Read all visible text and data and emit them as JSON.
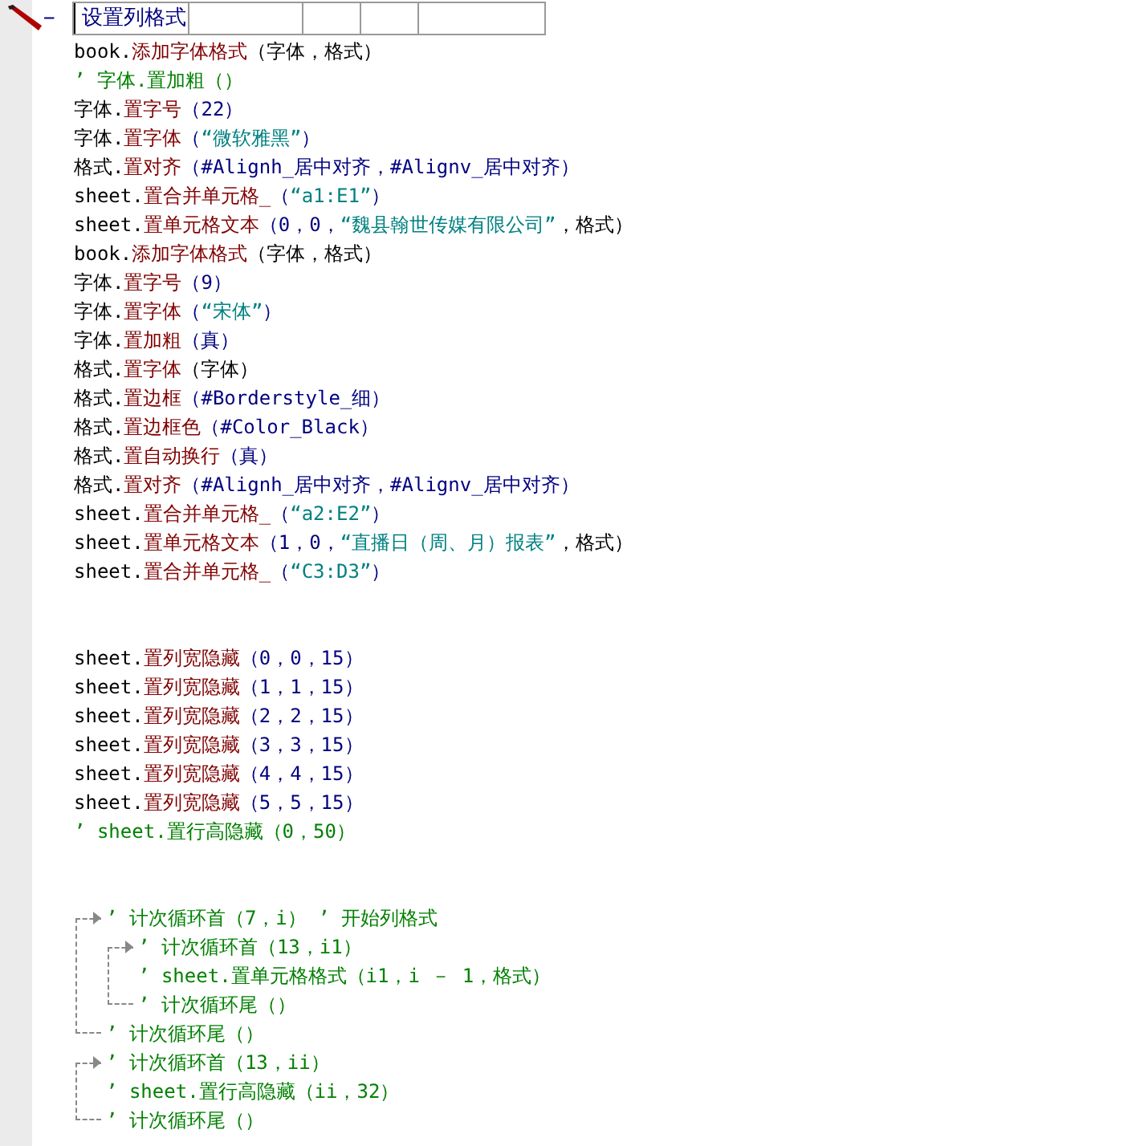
{
  "header": {
    "collapse_sign": "−",
    "title": "设置列格式"
  },
  "blocks": [
    {
      "items": [
        {
          "kind": "line",
          "segments": [
            {
              "text": "book.",
              "kind": "plain"
            },
            {
              "text": "添加字体格式",
              "kind": "method"
            },
            {
              "text": "（字体，格式）",
              "kind": "plain"
            }
          ]
        },
        {
          "kind": "line",
          "segments": [
            {
              "text": "’ 字体.置加粗（）",
              "kind": "comment"
            }
          ]
        },
        {
          "kind": "line",
          "segments": [
            {
              "text": "字体.",
              "kind": "plain"
            },
            {
              "text": "置字号",
              "kind": "method"
            },
            {
              "text": "（22）",
              "kind": "arg"
            }
          ]
        },
        {
          "kind": "line",
          "segments": [
            {
              "text": "字体.",
              "kind": "plain"
            },
            {
              "text": "置字体",
              "kind": "method"
            },
            {
              "text": "（",
              "kind": "arg"
            },
            {
              "text": "“微软雅黑”",
              "kind": "str"
            },
            {
              "text": "）",
              "kind": "arg"
            }
          ]
        },
        {
          "kind": "line",
          "segments": [
            {
              "text": "格式.",
              "kind": "plain"
            },
            {
              "text": "置对齐",
              "kind": "method"
            },
            {
              "text": "（#Alignh_居中对齐，#Alignv_居中对齐）",
              "kind": "arg"
            }
          ]
        },
        {
          "kind": "line",
          "segments": [
            {
              "text": "sheet.",
              "kind": "plain"
            },
            {
              "text": "置合并单元格_",
              "kind": "method"
            },
            {
              "text": "（",
              "kind": "arg"
            },
            {
              "text": "“a1:E1”",
              "kind": "str"
            },
            {
              "text": "）",
              "kind": "arg"
            }
          ]
        },
        {
          "kind": "line",
          "segments": [
            {
              "text": "sheet.",
              "kind": "plain"
            },
            {
              "text": "置单元格文本",
              "kind": "method"
            },
            {
              "text": "（0，0，",
              "kind": "arg"
            },
            {
              "text": "“魏县翰世传媒有限公司”",
              "kind": "str"
            },
            {
              "text": "，格式）",
              "kind": "plain"
            }
          ]
        },
        {
          "kind": "line",
          "segments": [
            {
              "text": "book.",
              "kind": "plain"
            },
            {
              "text": "添加字体格式",
              "kind": "method"
            },
            {
              "text": "（字体，格式）",
              "kind": "plain"
            }
          ]
        },
        {
          "kind": "line",
          "segments": [
            {
              "text": "字体.",
              "kind": "plain"
            },
            {
              "text": "置字号",
              "kind": "method"
            },
            {
              "text": "（9）",
              "kind": "arg"
            }
          ]
        },
        {
          "kind": "line",
          "segments": [
            {
              "text": "字体.",
              "kind": "plain"
            },
            {
              "text": "置字体",
              "kind": "method"
            },
            {
              "text": "（",
              "kind": "arg"
            },
            {
              "text": "“宋体”",
              "kind": "str"
            },
            {
              "text": "）",
              "kind": "arg"
            }
          ]
        },
        {
          "kind": "line",
          "segments": [
            {
              "text": "字体.",
              "kind": "plain"
            },
            {
              "text": "置加粗",
              "kind": "method"
            },
            {
              "text": "（真）",
              "kind": "arg"
            }
          ]
        },
        {
          "kind": "line",
          "segments": [
            {
              "text": "格式.",
              "kind": "plain"
            },
            {
              "text": "置字体",
              "kind": "method"
            },
            {
              "text": "（字体）",
              "kind": "plain"
            }
          ]
        },
        {
          "kind": "line",
          "segments": [
            {
              "text": "格式.",
              "kind": "plain"
            },
            {
              "text": "置边框",
              "kind": "method"
            },
            {
              "text": "（#Borderstyle_细）",
              "kind": "arg"
            }
          ]
        },
        {
          "kind": "line",
          "segments": [
            {
              "text": "格式.",
              "kind": "plain"
            },
            {
              "text": "置边框色",
              "kind": "method"
            },
            {
              "text": "（#Color_Black）",
              "kind": "arg"
            }
          ]
        },
        {
          "kind": "line",
          "segments": [
            {
              "text": "格式.",
              "kind": "plain"
            },
            {
              "text": "置自动换行",
              "kind": "method"
            },
            {
              "text": "（真）",
              "kind": "arg"
            }
          ]
        },
        {
          "kind": "line",
          "segments": [
            {
              "text": "格式.",
              "kind": "plain"
            },
            {
              "text": "置对齐",
              "kind": "method"
            },
            {
              "text": "（#Alignh_居中对齐，#Alignv_居中对齐）",
              "kind": "arg"
            }
          ]
        },
        {
          "kind": "line",
          "segments": [
            {
              "text": "sheet.",
              "kind": "plain"
            },
            {
              "text": "置合并单元格_",
              "kind": "method"
            },
            {
              "text": "（",
              "kind": "arg"
            },
            {
              "text": "“a2:E2”",
              "kind": "str"
            },
            {
              "text": "）",
              "kind": "arg"
            }
          ]
        },
        {
          "kind": "line",
          "segments": [
            {
              "text": "sheet.",
              "kind": "plain"
            },
            {
              "text": "置单元格文本",
              "kind": "method"
            },
            {
              "text": "（1，0，",
              "kind": "arg"
            },
            {
              "text": "“直播日（周、月）报表”",
              "kind": "str"
            },
            {
              "text": "，格式）",
              "kind": "plain"
            }
          ]
        },
        {
          "kind": "line",
          "segments": [
            {
              "text": "sheet.",
              "kind": "plain"
            },
            {
              "text": "置合并单元格_",
              "kind": "method"
            },
            {
              "text": "（",
              "kind": "arg"
            },
            {
              "text": "“C3:D3”",
              "kind": "str"
            },
            {
              "text": "）",
              "kind": "arg"
            }
          ]
        }
      ]
    },
    {
      "items": [
        {
          "kind": "line",
          "segments": [
            {
              "text": "sheet.",
              "kind": "plain"
            },
            {
              "text": "置列宽隐藏",
              "kind": "method"
            },
            {
              "text": "（0，0，15）",
              "kind": "arg"
            }
          ]
        },
        {
          "kind": "line",
          "segments": [
            {
              "text": "sheet.",
              "kind": "plain"
            },
            {
              "text": "置列宽隐藏",
              "kind": "method"
            },
            {
              "text": "（1，1，15）",
              "kind": "arg"
            }
          ]
        },
        {
          "kind": "line",
          "segments": [
            {
              "text": "sheet.",
              "kind": "plain"
            },
            {
              "text": "置列宽隐藏",
              "kind": "method"
            },
            {
              "text": "（2，2，15）",
              "kind": "arg"
            }
          ]
        },
        {
          "kind": "line",
          "segments": [
            {
              "text": "sheet.",
              "kind": "plain"
            },
            {
              "text": "置列宽隐藏",
              "kind": "method"
            },
            {
              "text": "（3，3，15）",
              "kind": "arg"
            }
          ]
        },
        {
          "kind": "line",
          "segments": [
            {
              "text": "sheet.",
              "kind": "plain"
            },
            {
              "text": "置列宽隐藏",
              "kind": "method"
            },
            {
              "text": "（4，4，15）",
              "kind": "arg"
            }
          ]
        },
        {
          "kind": "line",
          "segments": [
            {
              "text": "sheet.",
              "kind": "plain"
            },
            {
              "text": "置列宽隐藏",
              "kind": "method"
            },
            {
              "text": "（5，5，15）",
              "kind": "arg"
            }
          ]
        },
        {
          "kind": "line",
          "segments": [
            {
              "text": "’ sheet.置行高隐藏（0，50）",
              "kind": "comment"
            }
          ]
        }
      ]
    },
    {
      "items": [
        {
          "kind": "loop",
          "head": [
            {
              "text": "’ 计次循环首（7，i） ’ 开始列格式",
              "kind": "comment"
            }
          ],
          "children": [
            {
              "kind": "loop",
              "head": [
                {
                  "text": "’ 计次循环首（13，i1）",
                  "kind": "comment"
                }
              ],
              "children": [
                {
                  "kind": "line",
                  "segments": [
                    {
                      "text": "’ sheet.置单元格格式（i1，i － 1，格式）",
                      "kind": "comment"
                    }
                  ]
                }
              ],
              "tail": [
                {
                  "text": "’ 计次循环尾（）",
                  "kind": "comment"
                }
              ]
            }
          ],
          "tail": [
            {
              "text": "’ 计次循环尾（）",
              "kind": "comment"
            }
          ]
        },
        {
          "kind": "loop",
          "head": [
            {
              "text": "’ 计次循环首（13，ii）",
              "kind": "comment"
            }
          ],
          "children": [
            {
              "kind": "line",
              "segments": [
                {
                  "text": "’ sheet.置行高隐藏（ii，32）",
                  "kind": "comment"
                }
              ]
            }
          ],
          "tail": [
            {
              "text": "’ 计次循环尾（）",
              "kind": "comment"
            }
          ]
        }
      ]
    }
  ]
}
